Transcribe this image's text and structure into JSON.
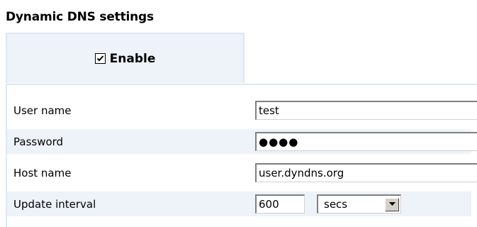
{
  "section": {
    "title": "Dynamic DNS settings"
  },
  "enable": {
    "label": "Enable",
    "checked": true
  },
  "form": {
    "username": {
      "label": "User name",
      "value": "test"
    },
    "password": {
      "label": "Password",
      "value": "●●●●"
    },
    "hostname": {
      "label": "Host name",
      "value": "user.dyndns.org"
    },
    "interval": {
      "label": "Update interval",
      "value": "600",
      "unit": "secs"
    }
  },
  "colors": {
    "panel_bg": "#eef3fa",
    "panel_border": "#dde7f3"
  },
  "icons": {
    "checkbox": "checkmark-icon",
    "dropdown": "chevron-down-icon"
  }
}
